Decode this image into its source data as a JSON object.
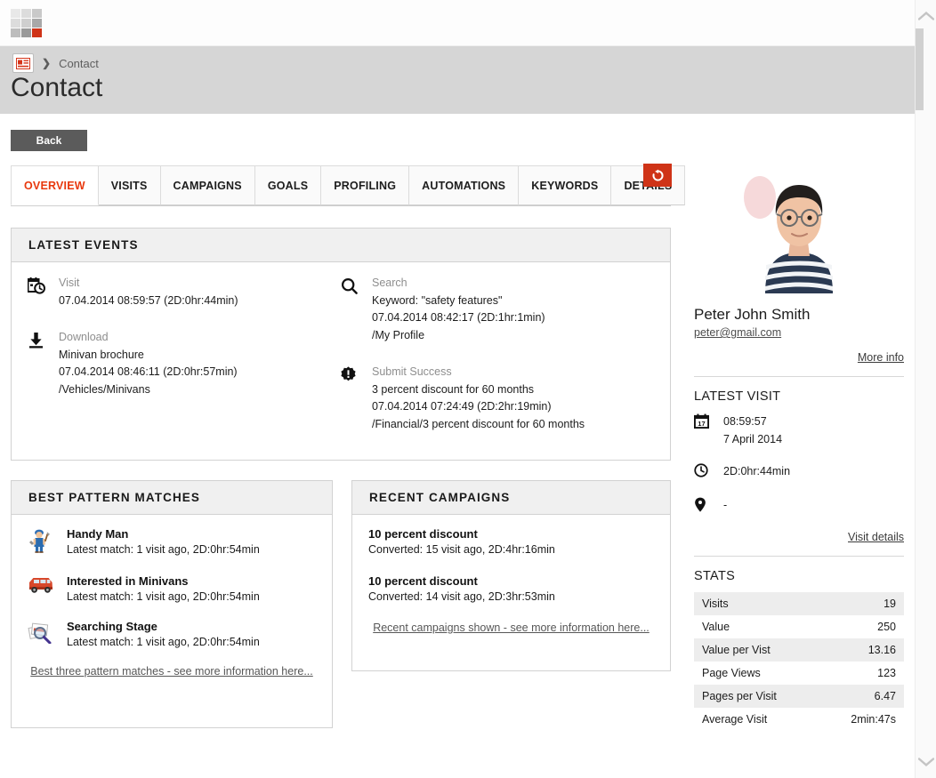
{
  "app": {
    "logo_cells": [
      "#e8e8e8",
      "#dcdcdc",
      "#c9c9c9",
      "#dcdcdc",
      "#cfcfcf",
      "#a8a8a8",
      "#bdbdbd",
      "#9a9a9a",
      "#cf3317"
    ],
    "accent_color": "#cf3317",
    "active_tab_color": "#e8380d"
  },
  "breadcrumb": {
    "icon": "contact-card-icon",
    "separator": "❯",
    "current": "Contact"
  },
  "page": {
    "title": "Contact"
  },
  "toolbar": {
    "back_label": "Back",
    "refresh_icon": "refresh-icon"
  },
  "tabs": [
    {
      "label": "OVERVIEW",
      "active": true
    },
    {
      "label": "VISITS",
      "active": false
    },
    {
      "label": "CAMPAIGNS",
      "active": false
    },
    {
      "label": "GOALS",
      "active": false
    },
    {
      "label": "PROFILING",
      "active": false
    },
    {
      "label": "AUTOMATIONS",
      "active": false
    },
    {
      "label": "KEYWORDS",
      "active": false
    },
    {
      "label": "DETAILS",
      "active": false
    }
  ],
  "latest_events": {
    "title": "LATEST EVENTS",
    "left_column": [
      {
        "icon": "calendar-clock-icon",
        "type": "Visit",
        "lines": [
          "07.04.2014 08:59:57 (2D:0hr:44min)"
        ]
      },
      {
        "icon": "download-icon",
        "type": "Download",
        "lines": [
          "Minivan brochure",
          "07.04.2014 08:46:11 (2D:0hr:57min)",
          "/Vehicles/Minivans"
        ]
      }
    ],
    "right_column": [
      {
        "icon": "search-icon",
        "type": "Search",
        "lines": [
          "Keyword: \"safety features\"",
          "07.04.2014 08:42:17 (2D:1hr:1min)",
          "/My Profile"
        ]
      },
      {
        "icon": "badge-alert-icon",
        "type": "Submit Success",
        "lines": [
          "3 percent discount for 60 months",
          "07.04.2014 07:24:49 (2D:2hr:19min)",
          "/Financial/3 percent discount for 60 months"
        ]
      }
    ]
  },
  "pattern_matches": {
    "title": "BEST PATTERN MATCHES",
    "items": [
      {
        "icon": "handyman-icon",
        "title": "Handy Man",
        "subtitle": "Latest match: 1 visit ago, 2D:0hr:54min"
      },
      {
        "icon": "minivan-icon",
        "title": "Interested in Minivans",
        "subtitle": "Latest match: 1 visit ago, 2D:0hr:54min"
      },
      {
        "icon": "magnifier-papers-icon",
        "title": "Searching Stage",
        "subtitle": "Latest match: 1 visit ago, 2D:0hr:54min"
      }
    ],
    "more_link": "Best three pattern matches - see more information here..."
  },
  "recent_campaigns": {
    "title": "RECENT CAMPAIGNS",
    "items": [
      {
        "title": "10 percent discount",
        "subtitle": "Converted: 15 visit ago, 2D:4hr:16min"
      },
      {
        "title": "10 percent discount",
        "subtitle": "Converted: 14 visit ago, 2D:3hr:53min"
      }
    ],
    "more_link": "Recent campaigns shown - see more information here..."
  },
  "sidebar": {
    "avatar": "contact-photo",
    "name": "Peter John Smith",
    "email": "peter@gmail.com",
    "more_info_link": "More info",
    "latest_visit": {
      "title": "LATEST VISIT",
      "time": "08:59:57",
      "date": "7 April 2014",
      "duration": "2D:0hr:44min",
      "location": "-",
      "calendar_day": "17",
      "details_link": "Visit details"
    },
    "stats": {
      "title": "STATS",
      "rows": [
        {
          "label": "Visits",
          "value": "19"
        },
        {
          "label": "Value",
          "value": "250"
        },
        {
          "label": "Value per Vist",
          "value": "13.16"
        },
        {
          "label": "Page Views",
          "value": "123"
        },
        {
          "label": "Pages per Visit",
          "value": "6.47"
        },
        {
          "label": "Average Visit",
          "value": "2min:47s"
        }
      ]
    }
  },
  "scrollbar": {
    "up_icon": "chevron-up-icon",
    "down_icon": "chevron-down-icon"
  }
}
